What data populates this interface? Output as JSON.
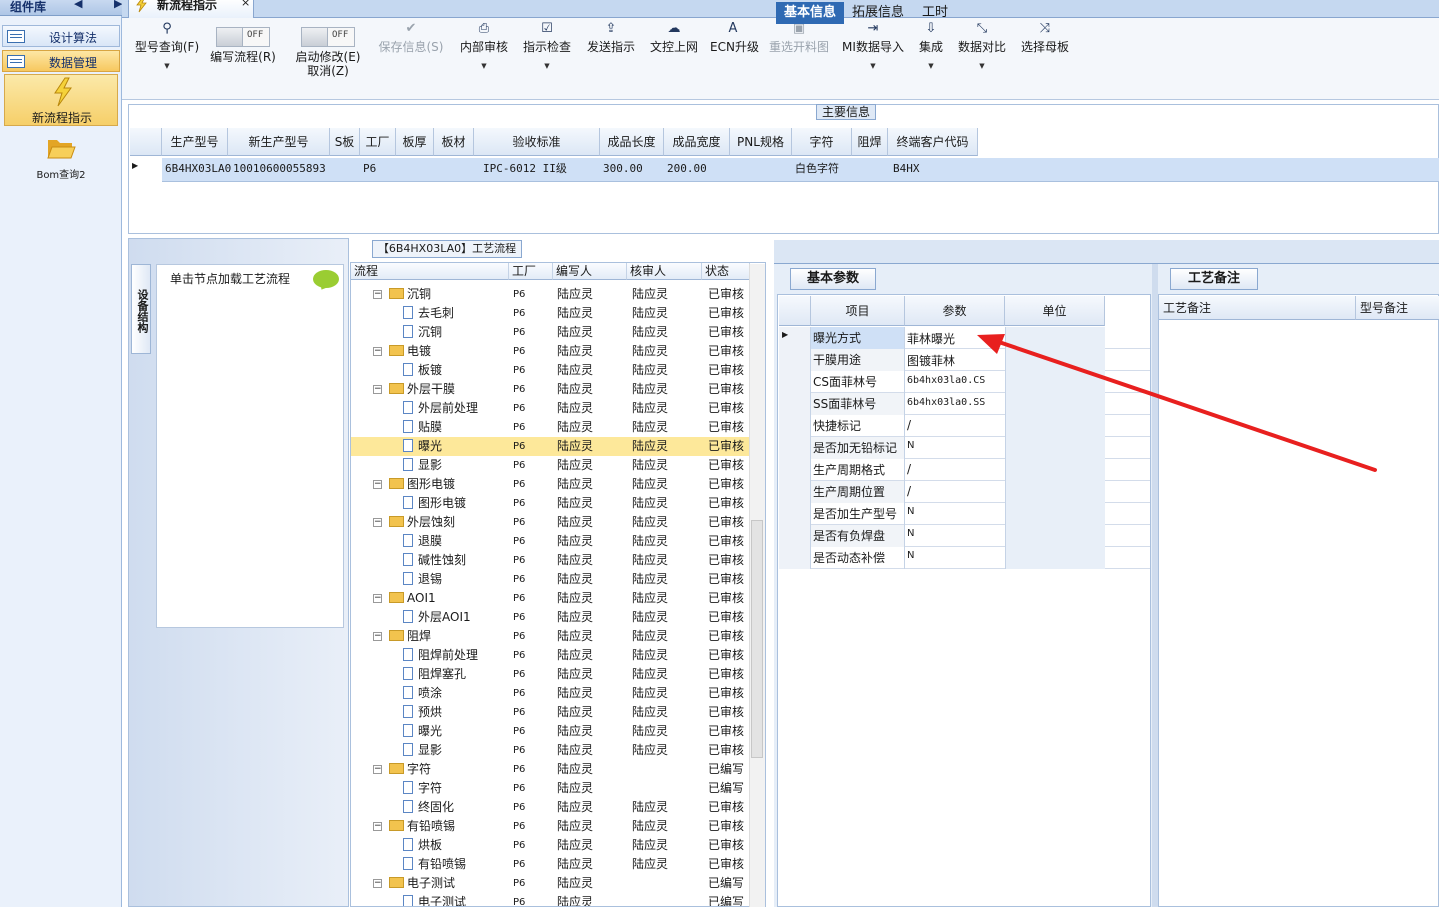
{
  "sidebar": {
    "title": "组件库",
    "arrows": "◀ ▶",
    "menus": [
      {
        "label": "设计算法"
      },
      {
        "label": "数据管理"
      }
    ],
    "items": [
      {
        "label": "新流程指示"
      },
      {
        "label": "Bom查询2"
      }
    ]
  },
  "doc_tab": {
    "label": "新流程指示",
    "close": "×"
  },
  "toolbar": {
    "search_label": "型号查询(F)",
    "write_flow_label": "编写流程(R)",
    "start_modify_label": "启动修改(E)",
    "cancel_label": "取消(Z)",
    "toggle_text": "OFF",
    "save_label": "保存信息(S)",
    "internal_review_label": "内部审核",
    "check_label": "指示检查",
    "send_label": "发送指示",
    "upload_label": "文控上网",
    "ecn_label": "ECN升级",
    "reselect_label": "重选开料图",
    "mi_import_label": "MI数据导入",
    "integrate_label": "集成",
    "compare_label": "数据对比",
    "select_master_label": "选择母板"
  },
  "main_info": {
    "title": "主要信息",
    "columns": [
      "生产型号",
      "新生产型号",
      "S板",
      "工厂",
      "板厚",
      "板材",
      "验收标准",
      "成品长度",
      "成品宽度",
      "PNL规格",
      "字符",
      "阻焊",
      "终端客户代码"
    ],
    "row": [
      "6B4HX03LA0",
      "10010600055893",
      "",
      "P6",
      "",
      "",
      "IPC-6012 II级",
      "300.00",
      "200.00",
      "",
      "白色字符",
      "",
      "B4HX"
    ]
  },
  "left_pane": {
    "vtab_label": "设备结构",
    "load_label": "单击节点加载工艺流程"
  },
  "tree": {
    "title": "【6B4HX03LA0】工艺流程",
    "columns": [
      "流程",
      "工厂",
      "编写人",
      "核审人",
      "状态"
    ],
    "rows": [
      {
        "name": "沉铜",
        "lvl": 0,
        "f": "P6",
        "w": "陆应灵",
        "r": "陆应灵",
        "s": "已审核"
      },
      {
        "name": "去毛刺",
        "lvl": 1,
        "f": "P6",
        "w": "陆应灵",
        "r": "陆应灵",
        "s": "已审核"
      },
      {
        "name": "沉铜",
        "lvl": 1,
        "f": "P6",
        "w": "陆应灵",
        "r": "陆应灵",
        "s": "已审核"
      },
      {
        "name": "电镀",
        "lvl": 0,
        "f": "P6",
        "w": "陆应灵",
        "r": "陆应灵",
        "s": "已审核"
      },
      {
        "name": "板镀",
        "lvl": 1,
        "f": "P6",
        "w": "陆应灵",
        "r": "陆应灵",
        "s": "已审核"
      },
      {
        "name": "外层干膜",
        "lvl": 0,
        "f": "P6",
        "w": "陆应灵",
        "r": "陆应灵",
        "s": "已审核"
      },
      {
        "name": "外层前处理",
        "lvl": 1,
        "f": "P6",
        "w": "陆应灵",
        "r": "陆应灵",
        "s": "已审核"
      },
      {
        "name": "贴膜",
        "lvl": 1,
        "f": "P6",
        "w": "陆应灵",
        "r": "陆应灵",
        "s": "已审核"
      },
      {
        "name": "曝光",
        "lvl": 1,
        "f": "P6",
        "w": "陆应灵",
        "r": "陆应灵",
        "s": "已审核",
        "sel": true
      },
      {
        "name": "显影",
        "lvl": 1,
        "f": "P6",
        "w": "陆应灵",
        "r": "陆应灵",
        "s": "已审核"
      },
      {
        "name": "图形电镀",
        "lvl": 0,
        "f": "P6",
        "w": "陆应灵",
        "r": "陆应灵",
        "s": "已审核"
      },
      {
        "name": "图形电镀",
        "lvl": 1,
        "f": "P6",
        "w": "陆应灵",
        "r": "陆应灵",
        "s": "已审核"
      },
      {
        "name": "外层蚀刻",
        "lvl": 0,
        "f": "P6",
        "w": "陆应灵",
        "r": "陆应灵",
        "s": "已审核"
      },
      {
        "name": "退膜",
        "lvl": 1,
        "f": "P6",
        "w": "陆应灵",
        "r": "陆应灵",
        "s": "已审核"
      },
      {
        "name": "碱性蚀刻",
        "lvl": 1,
        "f": "P6",
        "w": "陆应灵",
        "r": "陆应灵",
        "s": "已审核"
      },
      {
        "name": "退锡",
        "lvl": 1,
        "f": "P6",
        "w": "陆应灵",
        "r": "陆应灵",
        "s": "已审核"
      },
      {
        "name": "AOI1",
        "lvl": 0,
        "f": "P6",
        "w": "陆应灵",
        "r": "陆应灵",
        "s": "已审核"
      },
      {
        "name": "外层AOI1",
        "lvl": 1,
        "f": "P6",
        "w": "陆应灵",
        "r": "陆应灵",
        "s": "已审核"
      },
      {
        "name": "阻焊",
        "lvl": 0,
        "f": "P6",
        "w": "陆应灵",
        "r": "陆应灵",
        "s": "已审核"
      },
      {
        "name": "阻焊前处理",
        "lvl": 1,
        "f": "P6",
        "w": "陆应灵",
        "r": "陆应灵",
        "s": "已审核"
      },
      {
        "name": "阻焊塞孔",
        "lvl": 1,
        "f": "P6",
        "w": "陆应灵",
        "r": "陆应灵",
        "s": "已审核"
      },
      {
        "name": "喷涂",
        "lvl": 1,
        "f": "P6",
        "w": "陆应灵",
        "r": "陆应灵",
        "s": "已审核"
      },
      {
        "name": "预烘",
        "lvl": 1,
        "f": "P6",
        "w": "陆应灵",
        "r": "陆应灵",
        "s": "已审核"
      },
      {
        "name": "曝光",
        "lvl": 1,
        "f": "P6",
        "w": "陆应灵",
        "r": "陆应灵",
        "s": "已审核"
      },
      {
        "name": "显影",
        "lvl": 1,
        "f": "P6",
        "w": "陆应灵",
        "r": "陆应灵",
        "s": "已审核"
      },
      {
        "name": "字符",
        "lvl": 0,
        "f": "P6",
        "w": "陆应灵",
        "r": "",
        "s": "已编写"
      },
      {
        "name": "字符",
        "lvl": 1,
        "f": "P6",
        "w": "陆应灵",
        "r": "",
        "s": "已编写"
      },
      {
        "name": "终固化",
        "lvl": 1,
        "f": "P6",
        "w": "陆应灵",
        "r": "陆应灵",
        "s": "已审核"
      },
      {
        "name": "有铅喷锡",
        "lvl": 0,
        "f": "P6",
        "w": "陆应灵",
        "r": "陆应灵",
        "s": "已审核"
      },
      {
        "name": "烘板",
        "lvl": 1,
        "f": "P6",
        "w": "陆应灵",
        "r": "陆应灵",
        "s": "已审核"
      },
      {
        "name": "有铅喷锡",
        "lvl": 1,
        "f": "P6",
        "w": "陆应灵",
        "r": "陆应灵",
        "s": "已审核"
      },
      {
        "name": "电子测试",
        "lvl": 0,
        "f": "P6",
        "w": "陆应灵",
        "r": "",
        "s": "已编写"
      },
      {
        "name": "电子测试",
        "lvl": 1,
        "f": "P6",
        "w": "陆应灵",
        "r": "",
        "s": "已编写"
      }
    ]
  },
  "right_tabs": [
    "基本信息",
    "拓展信息",
    "工时"
  ],
  "params": {
    "tab_label": "基本参数",
    "columns": [
      "项目",
      "参数",
      "单位"
    ],
    "rows": [
      {
        "item": "曝光方式",
        "value": "菲林曝光",
        "unit": ""
      },
      {
        "item": "干膜用途",
        "value": "图镀菲林",
        "unit": ""
      },
      {
        "item": "CS面菲林号",
        "value": "6b4hx03la0.CS",
        "unit": ""
      },
      {
        "item": "SS面菲林号",
        "value": "6b4hx03la0.SS",
        "unit": ""
      },
      {
        "item": "快捷标记",
        "value": "/",
        "unit": ""
      },
      {
        "item": "是否加无铅标记",
        "value": "N",
        "unit": ""
      },
      {
        "item": "生产周期格式",
        "value": "/",
        "unit": ""
      },
      {
        "item": "生产周期位置",
        "value": "/",
        "unit": ""
      },
      {
        "item": "是否加生产型号",
        "value": "N",
        "unit": ""
      },
      {
        "item": "是否有负焊盘",
        "value": "N",
        "unit": ""
      },
      {
        "item": "是否动态补偿",
        "value": "N",
        "unit": ""
      }
    ]
  },
  "remarks": {
    "tab_label": "工艺备注",
    "col1": "工艺备注",
    "col2": "型号备注"
  },
  "colors": {
    "accent": "#2f6ab3",
    "selection": "#fde89a",
    "arrow": "#e8201f"
  }
}
